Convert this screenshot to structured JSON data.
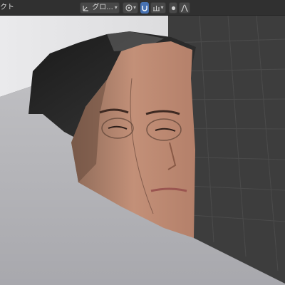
{
  "header": {
    "left_label": "クト",
    "transform_orientation": {
      "label": "グロ...",
      "icon": "orientation-axes-icon"
    },
    "pivot": {
      "icon": "pivot-point-icon"
    },
    "snap": {
      "icon": "magnet-icon",
      "enabled": true
    },
    "snap_target": {
      "icon": "snap-increment-icon"
    },
    "proportional": {
      "icon": "proportional-circle-icon",
      "falloff_icon": "falloff-curve-icon"
    }
  },
  "viewport": {
    "object": "textured-head-mesh",
    "colors": {
      "background": "#3d3d3d",
      "floor": "#b4b4b8",
      "wall": "#e4e4e6",
      "hair": "#141414",
      "skin": "#c28e78",
      "grid": "#525252"
    }
  }
}
